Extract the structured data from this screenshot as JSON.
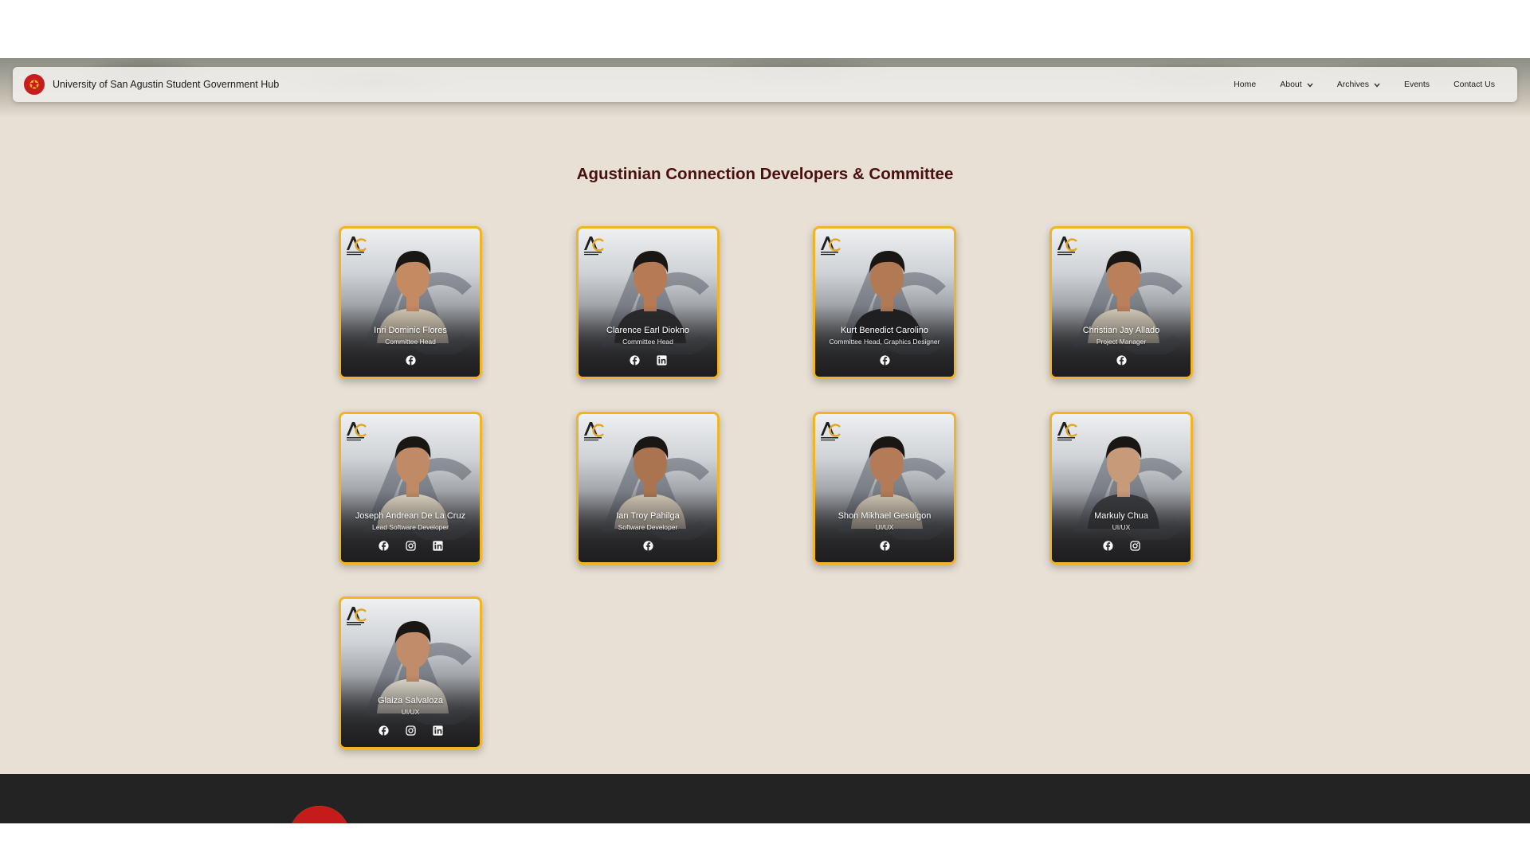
{
  "header": {
    "title": "University of San Agustin Student Government Hub",
    "nav": [
      {
        "label": "Home",
        "has_dropdown": false
      },
      {
        "label": "About",
        "has_dropdown": true
      },
      {
        "label": "Archives",
        "has_dropdown": true
      },
      {
        "label": "Events",
        "has_dropdown": false
      },
      {
        "label": "Contact Us",
        "has_dropdown": false
      }
    ]
  },
  "section": {
    "title": "Agustinian Connection Developers & Committee"
  },
  "members": [
    {
      "name": "Inri Dominic Flores",
      "role": "Committee Head",
      "socials": [
        "facebook"
      ]
    },
    {
      "name": "Clarence Earl Diokno",
      "role": "Committee Head",
      "socials": [
        "facebook",
        "linkedin"
      ]
    },
    {
      "name": "Kurt Benedict Carolino",
      "role": "Committee Head, Graphics Designer",
      "socials": [
        "facebook"
      ]
    },
    {
      "name": "Christian Jay Allado",
      "role": "Project Manager",
      "socials": [
        "facebook"
      ]
    },
    {
      "name": "Joseph Andrean De La Cruz",
      "role": "Lead Software Developer",
      "socials": [
        "facebook",
        "instagram",
        "linkedin"
      ]
    },
    {
      "name": "Ian Troy Pahilga",
      "role": "Software Developer",
      "socials": [
        "facebook"
      ]
    },
    {
      "name": "Shon Mikhael Gesulgon",
      "role": "UI/UX",
      "socials": [
        "facebook"
      ]
    },
    {
      "name": "Markuly Chua",
      "role": "UI/UX",
      "socials": [
        "facebook",
        "instagram"
      ]
    },
    {
      "name": "Glaiza Salvaloza",
      "role": "UI/UX",
      "socials": [
        "facebook",
        "instagram",
        "linkedin"
      ]
    }
  ],
  "colors": {
    "page_bg": "#e8e0d5",
    "title": "#4a0f0f",
    "card_border": "#f0b429",
    "footer_bg": "#232323",
    "accent_red": "#c81d1d"
  },
  "icons": {
    "brand": "university-seal-icon",
    "facebook": "facebook-icon",
    "instagram": "instagram-icon",
    "linkedin": "linkedin-icon",
    "dropdown": "chevron-down-icon"
  }
}
